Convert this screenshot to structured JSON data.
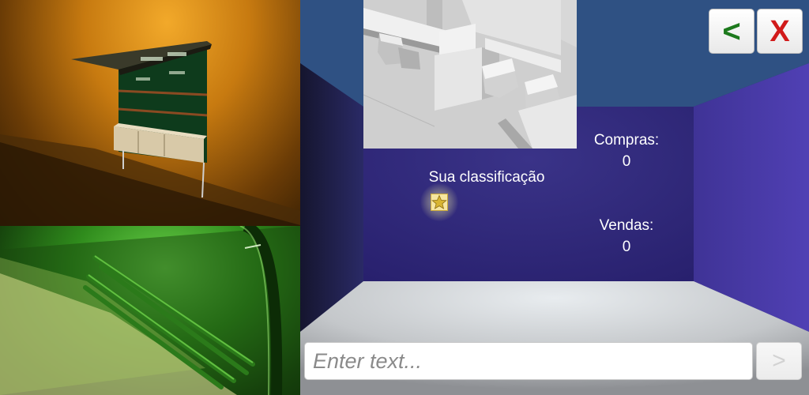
{
  "rating": {
    "label": "Sua classificação",
    "stars": 1,
    "star_icon": "star-icon"
  },
  "stats": {
    "purchases_label": "Compras:",
    "purchases_value": "0",
    "sales_label": "Vendas:",
    "sales_value": "0"
  },
  "nav": {
    "back_label": "<",
    "close_label": "X"
  },
  "chat": {
    "placeholder": "Enter text...",
    "send_label": ">"
  },
  "colors": {
    "room_back_wall": "#322c7c",
    "room_ceiling": "#2f5183",
    "room_right_wall": "#4b3aa8",
    "room_floor": "#c9cbcd",
    "back_button": "#1d7a1d",
    "close_button": "#d11a1a"
  }
}
